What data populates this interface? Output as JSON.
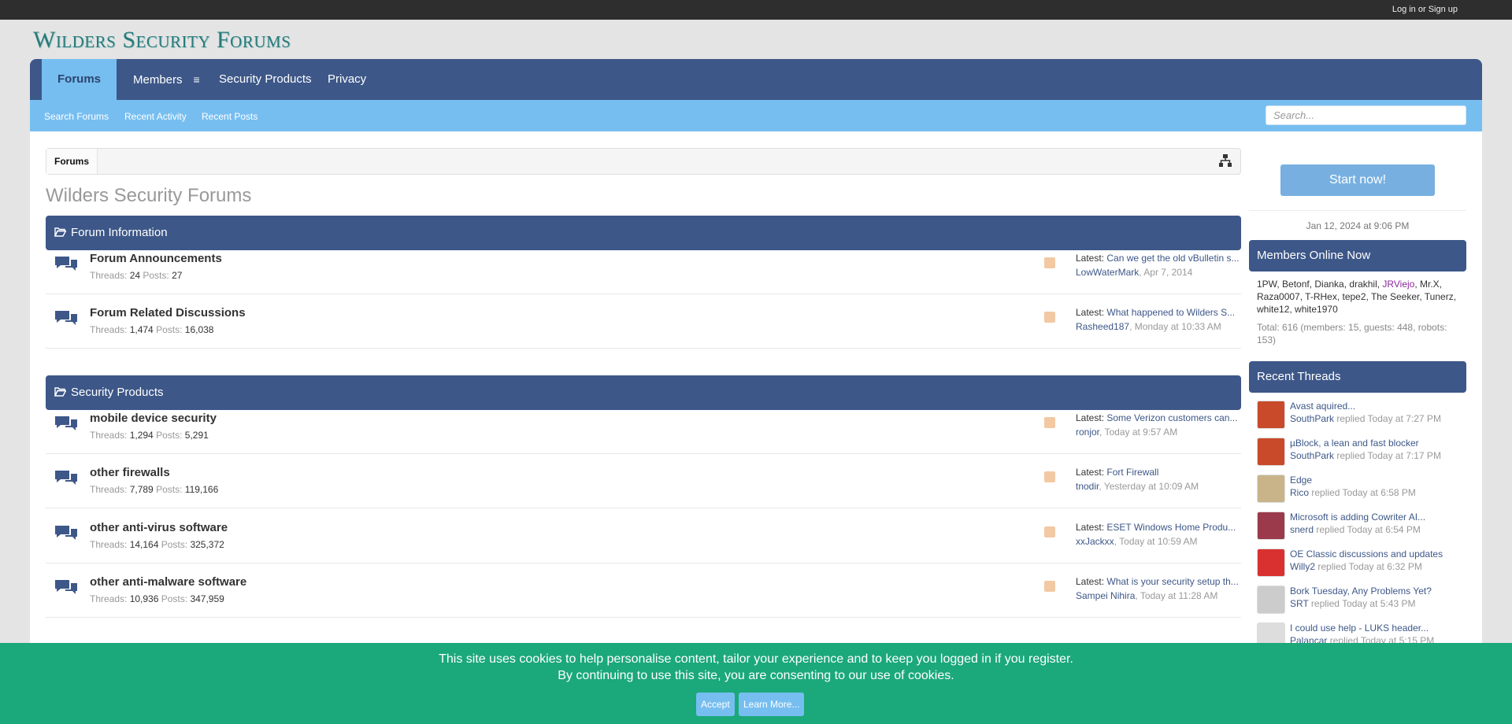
{
  "topbar": {
    "login": "Log in or Sign up"
  },
  "logo": "Wilders Security Forums",
  "nav": {
    "tabs": [
      "Forums",
      "Members",
      "Security Products",
      "Privacy"
    ],
    "sub": [
      "Search Forums",
      "Recent Activity",
      "Recent Posts"
    ],
    "search_placeholder": "Search..."
  },
  "breadcrumb": "Forums",
  "page_title": "Wilders Security Forums",
  "categories": [
    {
      "title": "Forum Information"
    },
    {
      "title": "Security Products"
    }
  ],
  "nodes": [
    {
      "title": "Forum Announcements",
      "threads": "24",
      "posts": "27",
      "latest": "Can we get the old vBulletin s...",
      "by": "LowWaterMark",
      "when": "Apr 7, 2014"
    },
    {
      "title": "Forum Related Discussions",
      "threads": "1,474",
      "posts": "16,038",
      "latest": "What happened to Wilders S...",
      "by": "Rasheed187",
      "when": "Monday at 10:33 AM"
    },
    {
      "title": "mobile device security",
      "threads": "1,294",
      "posts": "5,291",
      "latest": "Some Verizon customers can...",
      "by": "ronjor",
      "when": "Today at 9:57 AM"
    },
    {
      "title": "other firewalls",
      "threads": "7,789",
      "posts": "119,166",
      "latest": "Fort Firewall",
      "by": "tnodir",
      "when": "Yesterday at 10:09 AM"
    },
    {
      "title": "other anti-virus software",
      "threads": "14,164",
      "posts": "325,372",
      "latest": "ESET Windows Home Produ...",
      "by": "xxJackxx",
      "when": "Today at 10:59 AM"
    },
    {
      "title": "other anti-malware software",
      "threads": "10,936",
      "posts": "347,959",
      "latest": "What is your security setup th...",
      "by": "Sampei Nihira",
      "when": "Today at 11:28 AM"
    }
  ],
  "labels": {
    "threads": "Threads:",
    "posts": "Posts:",
    "latest": "Latest:"
  },
  "sidebar": {
    "start_button": "Start now!",
    "date": "Jan 12, 2024 at 9:06 PM",
    "members_online_title": "Members Online Now",
    "members_online_a": "1PW, Betonf, Dianka, drakhil, ",
    "members_online_purple": "JRViejo",
    "members_online_b": ", Mr.X, Raza0007, T-RHex, tepe2, The Seeker, Tunerz, white12, white1970",
    "total": "Total: 616 (members: 15, guests: 448, robots: 153)",
    "recent_threads_title": "Recent Threads",
    "replied": "replied",
    "recent_threads": [
      {
        "title": "Avast aquired...",
        "user": "SouthPark",
        "when": "Today at 7:27 PM"
      },
      {
        "title": "µBlock, a lean and fast blocker",
        "user": "SouthPark",
        "when": "Today at 7:17 PM"
      },
      {
        "title": "Edge",
        "user": "Rico",
        "when": "Today at 6:58 PM"
      },
      {
        "title": "Microsoft is adding Cowriter AI...",
        "user": "snerd",
        "when": "Today at 6:54 PM"
      },
      {
        "title": "OE Classic discussions and updates",
        "user": "Willy2",
        "when": "Today at 6:32 PM"
      },
      {
        "title": "Bork Tuesday, Any Problems Yet?",
        "user": "SRT",
        "when": "Today at 5:43 PM"
      },
      {
        "title": "I could use help - LUKS header...",
        "user": "Palancar",
        "when": "Today at 5:15 PM"
      }
    ]
  },
  "cookie": {
    "line1": "This site uses cookies to help personalise content, tailor your experience and to keep you logged in if you register.",
    "line2": "By continuing to use this site, you are consenting to our use of cookies.",
    "accept": "Accept",
    "learn_more": "Learn More..."
  },
  "colors": {
    "nav": "#3d5788",
    "subnav": "#77bef0",
    "cookie": "#1ba87a",
    "topbar": "#2e2e2e"
  }
}
